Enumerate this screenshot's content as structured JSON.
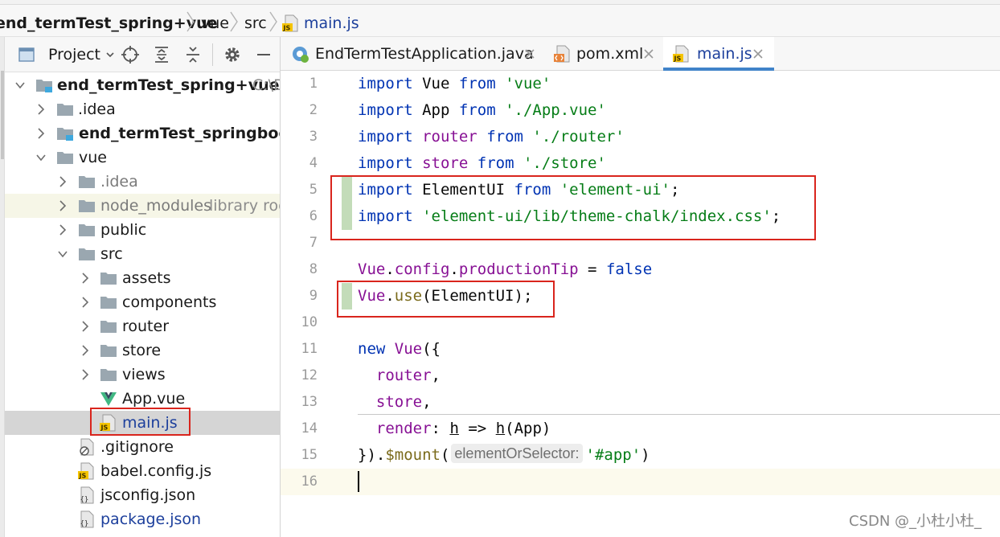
{
  "breadcrumb": [
    "end_termTest_spring+vue",
    "vue",
    "src",
    "main.js"
  ],
  "project_panel": {
    "title": "Project",
    "tree": [
      {
        "label": "end_termTest_spring+vue",
        "hint": "C:\\D",
        "icon": "module-folder-icon",
        "expanded": true
      },
      {
        "label": ".idea",
        "icon": "folder-icon",
        "expanded": false
      },
      {
        "label": "end_termTest_springboot",
        "icon": "module-folder-icon",
        "expanded": false
      },
      {
        "label": "vue",
        "icon": "folder-icon",
        "expanded": true
      },
      {
        "label": ".idea",
        "icon": "folder-icon",
        "expanded": false
      },
      {
        "label": "node_modules",
        "hint": "library roo",
        "icon": "folder-icon",
        "expanded": false
      },
      {
        "label": "public",
        "icon": "folder-icon",
        "expanded": false
      },
      {
        "label": "src",
        "icon": "folder-icon",
        "expanded": true
      },
      {
        "label": "assets",
        "icon": "folder-icon",
        "expanded": false
      },
      {
        "label": "components",
        "icon": "folder-icon",
        "expanded": false
      },
      {
        "label": "router",
        "icon": "folder-icon",
        "expanded": false
      },
      {
        "label": "store",
        "icon": "folder-icon",
        "expanded": false
      },
      {
        "label": "views",
        "icon": "folder-icon",
        "expanded": false
      },
      {
        "label": "App.vue",
        "icon": "vue-file-icon"
      },
      {
        "label": "main.js",
        "icon": "js-file-icon",
        "selected": true
      },
      {
        "label": ".gitignore",
        "icon": "gitignore-file-icon"
      },
      {
        "label": "babel.config.js",
        "icon": "js-file-icon"
      },
      {
        "label": "jsconfig.json",
        "icon": "json-file-icon"
      },
      {
        "label": "package.json",
        "icon": "json-file-icon"
      }
    ]
  },
  "editor_tabs": [
    {
      "label": "EndTermTestApplication.java",
      "icon": "spring-java-icon"
    },
    {
      "label": "pom.xml",
      "icon": "xml-file-icon"
    },
    {
      "label": "main.js",
      "icon": "js-file-icon",
      "active": true
    }
  ],
  "code": {
    "line_numbers": [
      "1",
      "2",
      "3",
      "4",
      "5",
      "6",
      "7",
      "8",
      "9",
      "10",
      "11",
      "12",
      "13",
      "14",
      "15",
      "16"
    ],
    "lines": [
      [
        [
          "kw",
          "import"
        ],
        [
          "",
          "Vue"
        ],
        [
          "kw",
          "from"
        ],
        [
          "str",
          "'vue'"
        ]
      ],
      [
        [
          "kw",
          "import"
        ],
        [
          "",
          "App"
        ],
        [
          "kw",
          "from"
        ],
        [
          "str",
          "'./App.vue'"
        ]
      ],
      [
        [
          "kw",
          "import"
        ],
        [
          "prop",
          "router"
        ],
        [
          "kw",
          "from"
        ],
        [
          "str",
          "'./router'"
        ]
      ],
      [
        [
          "kw",
          "import"
        ],
        [
          "prop",
          "store"
        ],
        [
          "kw",
          "from"
        ],
        [
          "str",
          "'./store'"
        ]
      ],
      [
        [
          "kw",
          "import"
        ],
        [
          "",
          "ElementUI"
        ],
        [
          "kw",
          "from"
        ],
        [
          "str",
          "'element-ui'"
        ],
        [
          "",
          ";"
        ]
      ],
      [
        [
          "kw",
          "import"
        ],
        [
          "str",
          "'element-ui/lib/theme-chalk/index.css'"
        ],
        [
          "",
          ";"
        ]
      ],
      [],
      [
        [
          "prop",
          "Vue"
        ],
        [
          "",
          "."
        ],
        [
          "prop",
          "config"
        ],
        [
          "",
          "."
        ],
        [
          "prop",
          "productionTip"
        ],
        [
          "",
          "="
        ],
        [
          "kw",
          "false"
        ]
      ],
      [
        [
          "prop",
          "Vue"
        ],
        [
          "",
          "."
        ],
        [
          "fn",
          "use"
        ],
        [
          "",
          "(ElementUI);"
        ]
      ],
      [],
      [
        [
          "kw",
          "new"
        ],
        [
          "prop",
          "Vue"
        ],
        [
          "",
          "({"
        ]
      ],
      [
        [
          "prop",
          "router"
        ],
        [
          "",
          ","
        ]
      ],
      [
        [
          "prop",
          "store"
        ],
        [
          "",
          ","
        ]
      ],
      [
        [
          "prop",
          "render"
        ],
        [
          "",
          ":"
        ],
        [
          "",
          "h"
        ],
        [
          "",
          "=>"
        ],
        [
          "",
          "h"
        ],
        [
          "",
          "(App)"
        ]
      ],
      [
        [
          "",
          "})."
        ],
        [
          "fn",
          "$mount"
        ],
        [
          "",
          "("
        ],
        [
          "",
          "elementOrSelector:"
        ],
        [
          "str",
          "'#app'"
        ],
        [
          "",
          ")"
        ]
      ],
      []
    ]
  },
  "watermark": "CSDN @_小杜小杜_"
}
